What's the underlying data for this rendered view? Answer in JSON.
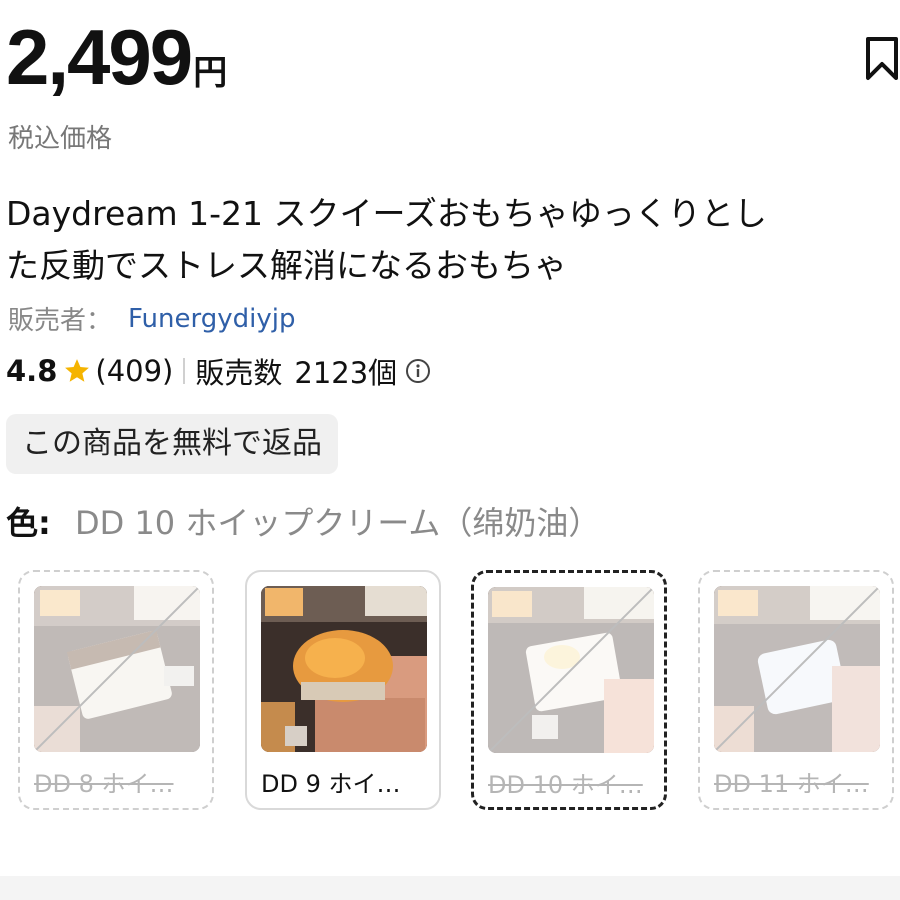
{
  "price": {
    "amount": "2,499",
    "currency": "円",
    "tax_note": "税込価格"
  },
  "title": {
    "line1": "Daydream 1-21 スクイーズおもちゃゆっくりとし",
    "line2": "た反動でストレス解消になるおもちゃ"
  },
  "seller": {
    "label": "販売者：",
    "name": "Funergydiyjp"
  },
  "rating": {
    "score": "4.8",
    "count": "(409)",
    "sold_label": "販売数",
    "sold_count": "2123個"
  },
  "return_badge": "この商品を無料で返品",
  "color_option": {
    "label": "色:",
    "value": "DD 10 ホイップクリーム（绵奶油）"
  },
  "variants": [
    {
      "label": "DD 8 ホイ…",
      "state": "unavailable"
    },
    {
      "label": "DD 9 ホイ…",
      "state": "available"
    },
    {
      "label": "DD 10 ホイ…",
      "state": "selected-unavailable"
    },
    {
      "label": "DD 11 ホイ…",
      "state": "unavailable"
    }
  ],
  "icons": {
    "bookmark": "bookmark-icon",
    "star": "star-icon",
    "info": "info-icon"
  },
  "colors": {
    "link": "#2f5fa8",
    "star": "#f5b400",
    "muted": "#888888",
    "badge_bg": "#f0f0f0"
  }
}
